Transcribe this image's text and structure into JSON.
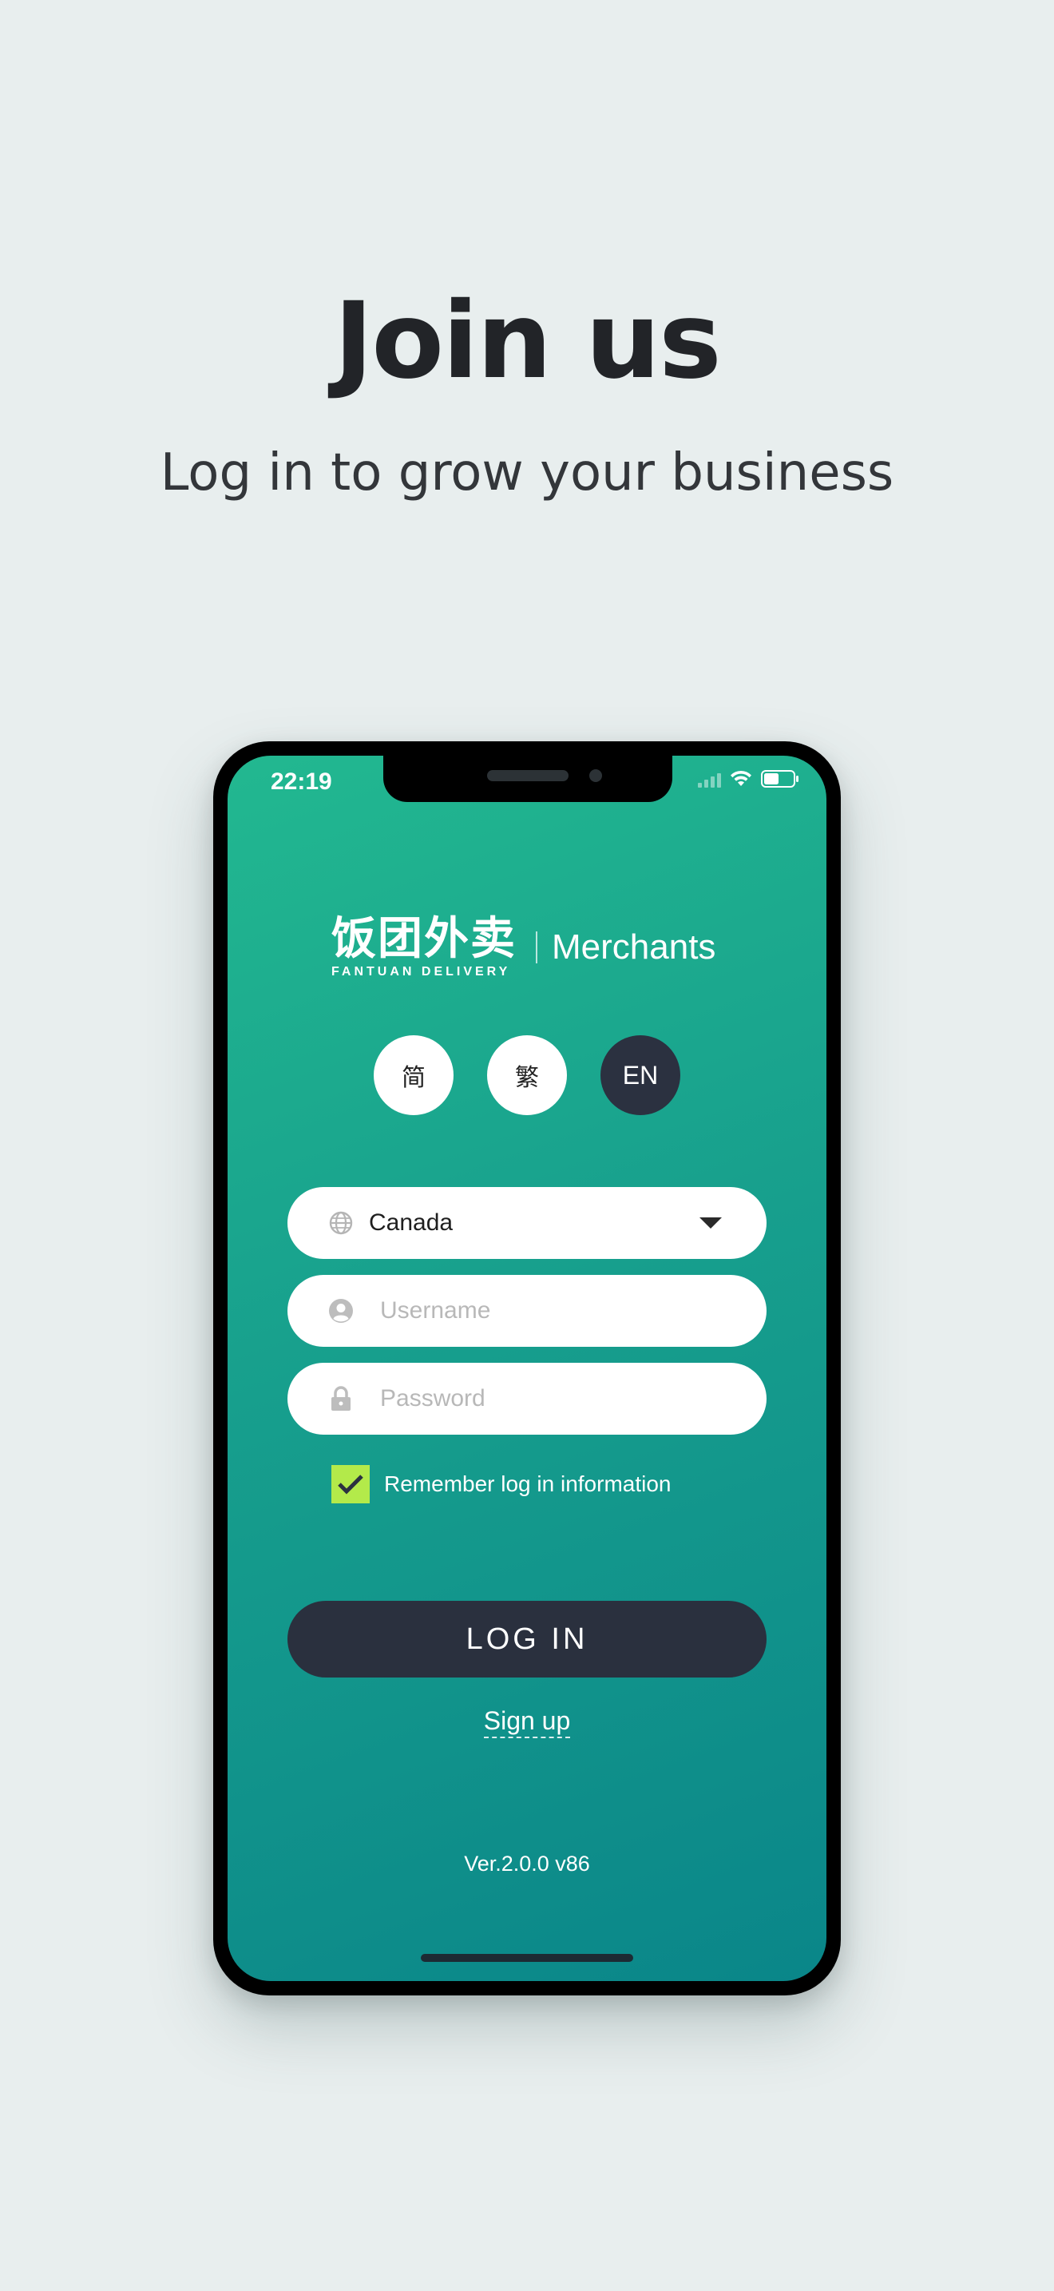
{
  "hero": {
    "title": "Join us",
    "subtitle": "Log in to grow your business"
  },
  "status_bar": {
    "time": "22:19",
    "icons": [
      "signal-icon",
      "wifi-icon",
      "battery-icon"
    ]
  },
  "brand": {
    "name_cn": "饭团外卖",
    "name_en": "FANTUAN DELIVERY",
    "section": "Merchants"
  },
  "languages": [
    {
      "label": "简",
      "active": false
    },
    {
      "label": "繁",
      "active": false
    },
    {
      "label": "EN",
      "active": true
    }
  ],
  "form": {
    "country": "Canada",
    "username_placeholder": "Username",
    "password_placeholder": "Password",
    "remember_label": "Remember log in information",
    "remember_checked": true,
    "login_label": "LOG IN",
    "signup_label": "Sign up"
  },
  "footer": {
    "version": "Ver.2.0.0 v86"
  },
  "colors": {
    "background": "#e8eeee",
    "screen_gradient_start": "#22b890",
    "screen_gradient_end": "#0a8689",
    "dark_button": "#2a303e",
    "checkbox": "#b3ea4a"
  }
}
